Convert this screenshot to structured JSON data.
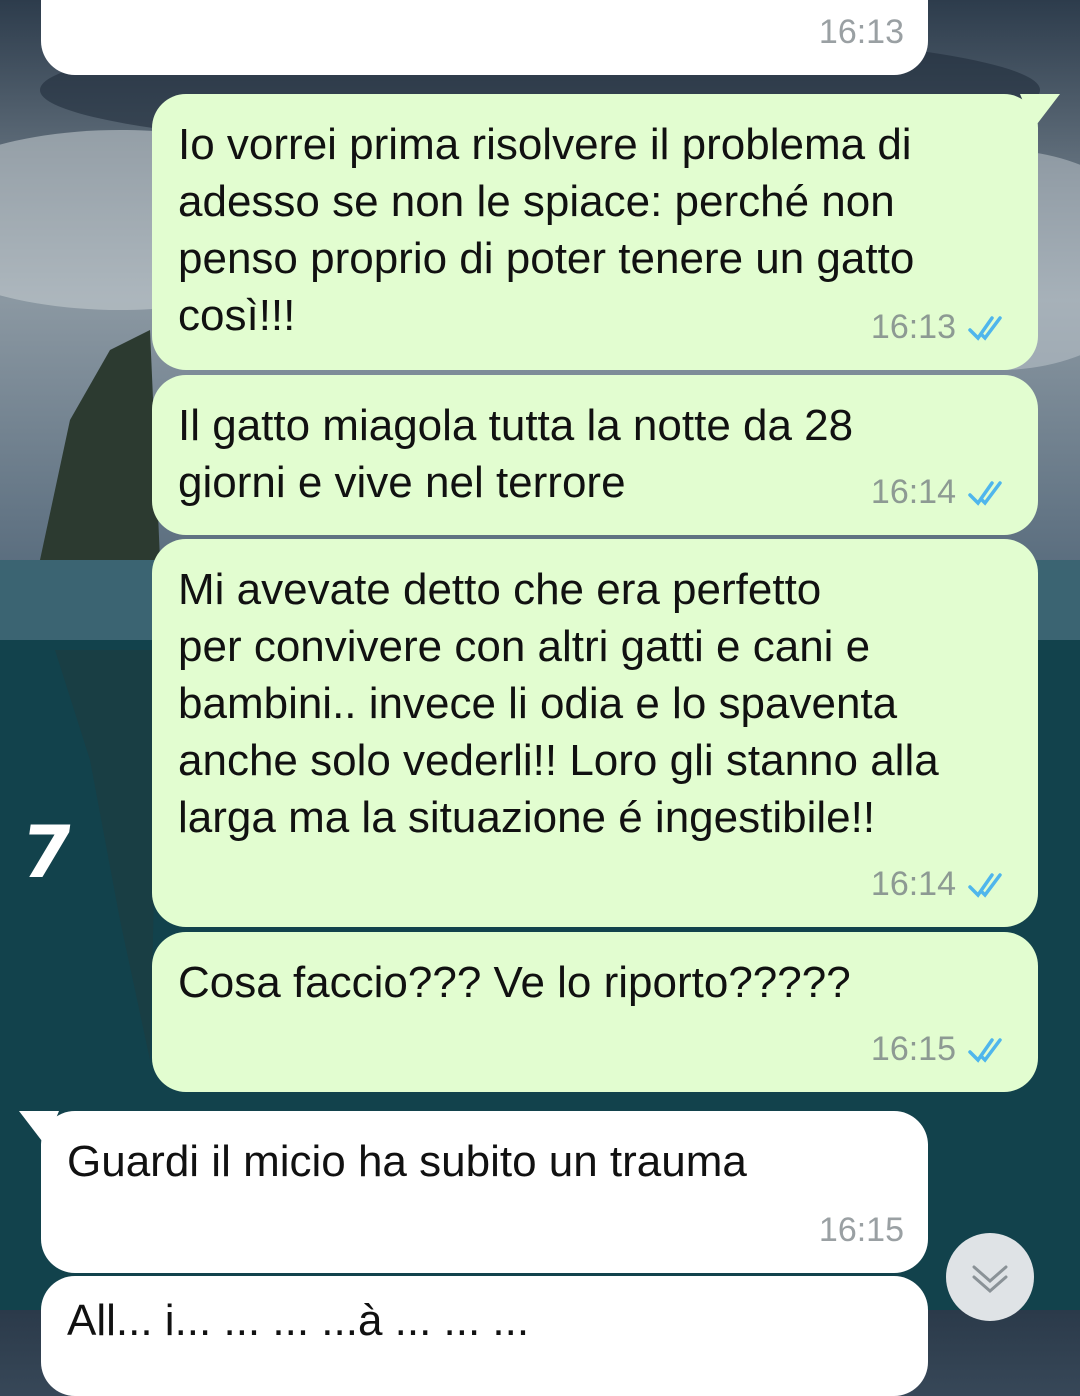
{
  "chat": {
    "messages": [
      {
        "dir": "in",
        "text": "",
        "time": "16:13"
      },
      {
        "dir": "out",
        "text": "Io vorrei prima risolvere il problema di\nadesso se non le spiace: perché non\npenso proprio di poter tenere un gatto\ncosì!!!",
        "time": "16:13",
        "status": "read"
      },
      {
        "dir": "out",
        "text": "Il gatto miagola tutta la notte da 28\ngiorni e vive nel terrore",
        "time": "16:14",
        "status": "read"
      },
      {
        "dir": "out",
        "text": "Mi avevate detto che era perfetto\nper convivere con altri gatti e cani e\nbambini.. invece li odia e lo spaventa\nanche solo vederli!! Loro gli stanno alla\nlarga ma la situazione é ingestibile!!",
        "time": "16:14",
        "status": "read"
      },
      {
        "dir": "out",
        "text": "Cosa faccio??? Ve lo riporto?????",
        "time": "16:15",
        "status": "read"
      },
      {
        "dir": "in",
        "text": "Guardi il micio ha subito un trauma",
        "time": "16:15"
      },
      {
        "dir": "in",
        "text": "All... i... ... ... ...à ... ... ...",
        "time": ""
      }
    ]
  },
  "overlay": {
    "mark": "7"
  },
  "colors": {
    "outgoing": "#e2fdd0",
    "incoming": "#ffffff",
    "read_ticks": "#4fb6ec"
  },
  "icons": {
    "read": "double-check-icon",
    "scroll": "chevron-down-icon"
  }
}
